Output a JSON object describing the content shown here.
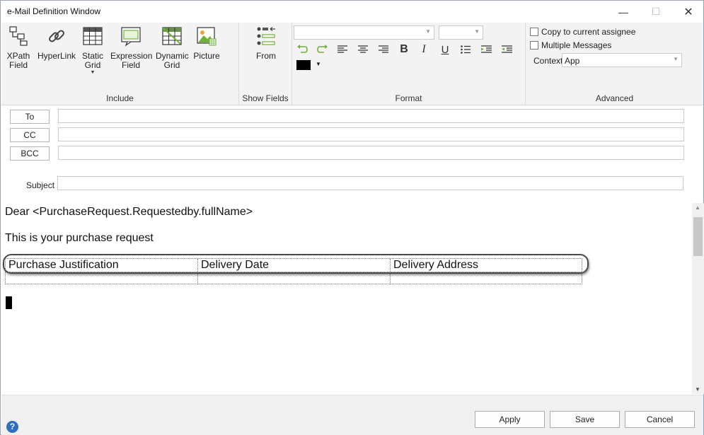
{
  "window": {
    "title": "e-Mail Definition Window",
    "min_glyph": "—",
    "max_glyph": "☐",
    "close_glyph": "✕"
  },
  "ribbon": {
    "include": {
      "label": "Include",
      "buttons": [
        {
          "label1": "XPath",
          "label2": "Field",
          "icon": "xpath-field-icon"
        },
        {
          "label1": "HyperLink",
          "label2": "",
          "icon": "hyperlink-icon"
        },
        {
          "label1": "Static",
          "label2": "Grid",
          "icon": "static-grid-icon"
        },
        {
          "label1": "Expression",
          "label2": "Field",
          "icon": "expression-field-icon"
        },
        {
          "label1": "Dynamic",
          "label2": "Grid",
          "icon": "dynamic-grid-icon"
        },
        {
          "label1": "Picture",
          "label2": "",
          "icon": "picture-icon"
        }
      ]
    },
    "show_fields": {
      "label": "Show Fields",
      "from_label": "From"
    },
    "format": {
      "label": "Format",
      "font_value": "",
      "size_value": ""
    },
    "advanced": {
      "label": "Advanced",
      "copy_label": "Copy to current assignee",
      "multiple_label": "Multiple Messages",
      "context_label": "Context",
      "context_value": "App"
    }
  },
  "header": {
    "to": "To",
    "cc": "CC",
    "bcc": "BCC",
    "subject": "Subject"
  },
  "editor": {
    "line1": "Dear <PurchaseRequest.Requestedby.fullName>",
    "line2": "This is your purchase request",
    "grid_headers": [
      "Purchase Justification",
      "Delivery Date",
      "Delivery Address"
    ]
  },
  "footer": {
    "apply": "Apply",
    "save": "Save",
    "cancel": "Cancel",
    "help": "?"
  },
  "colors": {
    "accent": "#2f6fbe",
    "ribbon_bg": "#f3f3f3",
    "icon_green": "#6fb23a"
  }
}
